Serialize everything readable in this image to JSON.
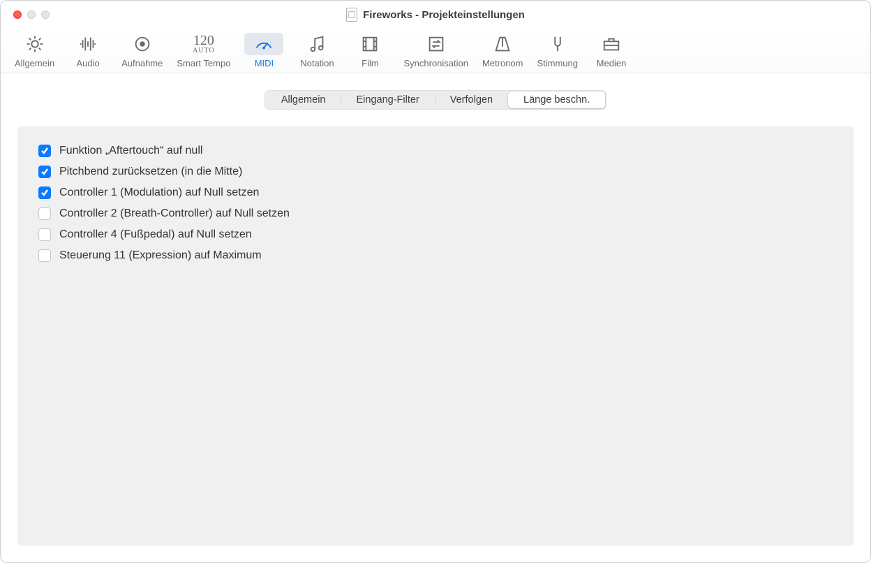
{
  "window": {
    "title": "Fireworks - Projekteinstellungen"
  },
  "toolbar": [
    {
      "id": "general",
      "label": "Allgemein",
      "icon": "gear",
      "active": false
    },
    {
      "id": "audio",
      "label": "Audio",
      "icon": "waveform",
      "active": false
    },
    {
      "id": "record",
      "label": "Aufnahme",
      "icon": "record",
      "active": false
    },
    {
      "id": "tempo",
      "label": "Smart Tempo",
      "icon": "smart-tempo",
      "active": false
    },
    {
      "id": "midi",
      "label": "MIDI",
      "icon": "gauge",
      "active": true
    },
    {
      "id": "notation",
      "label": "Notation",
      "icon": "notes",
      "active": false
    },
    {
      "id": "film",
      "label": "Film",
      "icon": "filmstrip",
      "active": false
    },
    {
      "id": "sync",
      "label": "Synchronisation",
      "icon": "sync",
      "active": false
    },
    {
      "id": "metronome",
      "label": "Metronom",
      "icon": "metronome",
      "active": false
    },
    {
      "id": "tuning",
      "label": "Stimmung",
      "icon": "tuning-fork",
      "active": false
    },
    {
      "id": "media",
      "label": "Medien",
      "icon": "briefcase",
      "active": false
    }
  ],
  "smart_tempo": {
    "big": "120",
    "small": "AUTO"
  },
  "segments": [
    {
      "id": "general",
      "label": "Allgemein",
      "active": false
    },
    {
      "id": "input",
      "label": "Eingang-Filter",
      "active": false
    },
    {
      "id": "chase",
      "label": "Verfolgen",
      "active": false
    },
    {
      "id": "clip",
      "label": "Länge beschn.",
      "active": true
    }
  ],
  "checks": [
    {
      "id": "aftertouch",
      "label": "Funktion „Aftertouch“ auf null",
      "checked": true
    },
    {
      "id": "pitchbend",
      "label": "Pitchbend zurücksetzen (in die Mitte)",
      "checked": true
    },
    {
      "id": "ctrl1",
      "label": "Controller 1 (Modulation) auf Null setzen",
      "checked": true
    },
    {
      "id": "ctrl2",
      "label": "Controller 2 (Breath-Controller) auf Null setzen",
      "checked": false
    },
    {
      "id": "ctrl4",
      "label": "Controller 4 (Fußpedal) auf Null setzen",
      "checked": false
    },
    {
      "id": "ctrl11",
      "label": "Steuerung 11 (Expression) auf Maximum",
      "checked": false
    }
  ]
}
